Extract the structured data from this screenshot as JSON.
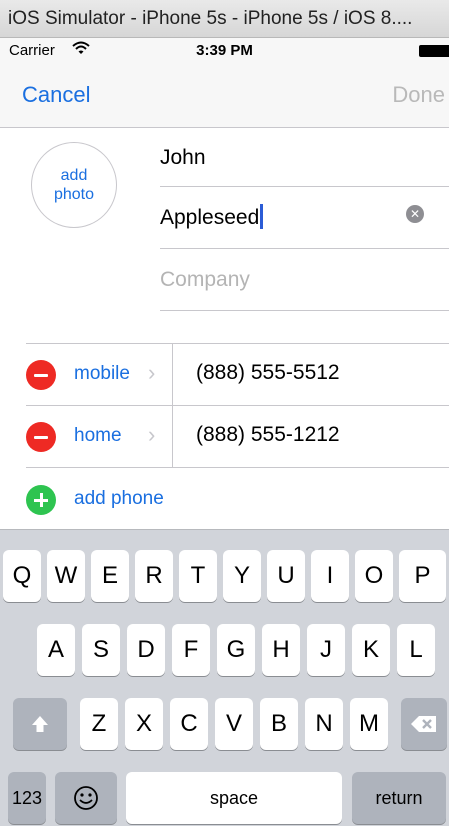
{
  "simulator": {
    "title": "iOS Simulator - iPhone 5s - iPhone 5s / iOS 8...."
  },
  "status_bar": {
    "carrier": "Carrier",
    "time": "3:39 PM"
  },
  "nav": {
    "cancel": "Cancel",
    "done": "Done"
  },
  "photo": {
    "label": "add photo"
  },
  "fields": {
    "first_name": "John",
    "last_name": "Appleseed",
    "company_placeholder": "Company"
  },
  "phones": [
    {
      "label": "mobile",
      "number": "(888) 555-5512"
    },
    {
      "label": "home",
      "number": "(888) 555-1212"
    }
  ],
  "add_phone": "add phone",
  "keyboard": {
    "row1": [
      "Q",
      "W",
      "E",
      "R",
      "T",
      "Y",
      "U",
      "I",
      "O",
      "P"
    ],
    "row2": [
      "A",
      "S",
      "D",
      "F",
      "G",
      "H",
      "J",
      "K",
      "L"
    ],
    "row3": [
      "Z",
      "X",
      "C",
      "V",
      "B",
      "N",
      "M"
    ],
    "numbers_key": "123",
    "space_key": "space",
    "return_key": "return"
  },
  "colors": {
    "tint": "#1a6fe0",
    "delete_red": "#ee2a24",
    "add_green": "#2ec450",
    "keyboard_bg": "#d1d4da"
  }
}
